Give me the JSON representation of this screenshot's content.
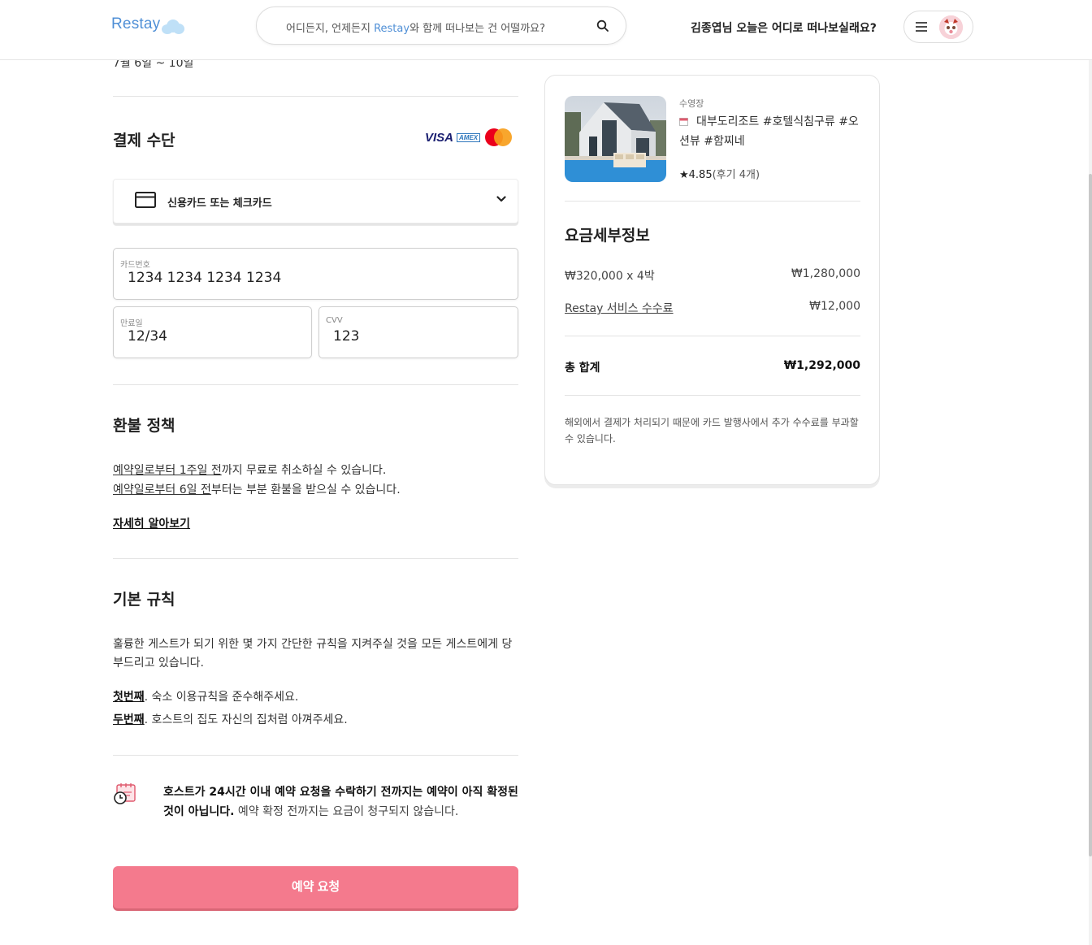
{
  "header": {
    "logo": "Restay",
    "search_prefix": "어디든지, 언제든지 ",
    "search_brand": "Restay",
    "search_suffix": "와 함께 떠나보는 건 어떨까요?",
    "greeting": "김종엽님 오늘은 어디로 떠나보실래요?"
  },
  "top_cut_text": "7월 6일 ~ 10일",
  "payment": {
    "title": "결제 수단",
    "logos": {
      "visa": "VISA",
      "amex": "AMEX"
    },
    "method_label": "신용카드 또는 체크카드",
    "card_number_label": "카드번호",
    "card_number": "1234 1234 1234 1234",
    "expiry_label": "만료일",
    "expiry": "12/34",
    "cvv_label": "CVV",
    "cvv": "123"
  },
  "refund": {
    "title": "환불 정책",
    "line1_link": "예약일로부터 1주일 전",
    "line1_rest": "까지 무료로 취소하실 수 있습니다.",
    "line2_link": "예약일로부터 6일 전",
    "line2_rest": "부터는 부분 환불을 받으실 수 있습니다.",
    "learn_more": "자세히 알아보기"
  },
  "rules": {
    "title": "기본 규칙",
    "intro": "훌륭한 게스트가 되기 위한 몇 가지 간단한 규칙을 지켜주실 것을 모든 게스트에게 당부드리고 있습니다.",
    "first_label": "첫번째",
    "first_text": ". 숙소 이용규칙을 준수해주세요.",
    "second_label": "두번째",
    "second_text": ". 호스트의 집도 자신의 집처럼 아껴주세요."
  },
  "notice": {
    "bold": "호스트가 24시간 이내 예약 요청을 수락하기 전까지는 예약이 아직 확정된 것이 아닙니다.",
    "rest": " 예약 확정 전까지는 요금이 청구되지 않습니다."
  },
  "reserve_button": "예약 요청",
  "summary": {
    "type": "수영장",
    "name": "대부도리조트 #호텔식침구류 #오션뷰 #함찌네",
    "rating": "★4.85",
    "review_count": "(후기 4개)",
    "price_title": "요금세부정보",
    "nightly": "₩320,000 x 4박",
    "nightly_total": "₩1,280,000",
    "fee_label": "Restay 서비스 수수료",
    "fee": "₩12,000",
    "total_label": "총 합계",
    "total": "₩1,292,000",
    "note": "해외에서 결제가 처리되기 때문에 카드 발행사에서 추가 수수료를 부과할 수 있습니다."
  },
  "colors": {
    "accent_pink": "#f47a8d",
    "brand_blue": "#4f8fd6"
  }
}
